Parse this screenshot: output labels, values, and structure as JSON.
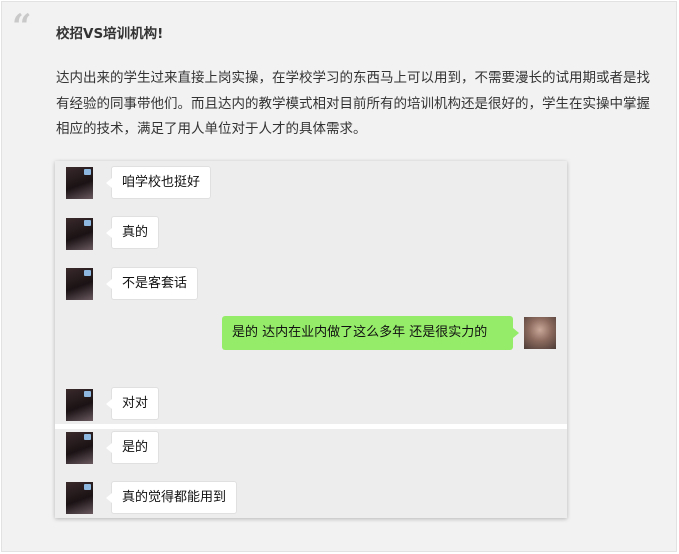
{
  "article": {
    "heading": "校招VS培训机构!",
    "paragraph": "达内出来的学生过来直接上岗实操，在学校学习的东西马上可以用到，不需要漫长的试用期或者是找有经验的同事带他们。而且达内的教学模式相对目前所有的培训机构还是很好的，学生在实操中掌握相应的技术，满足了用人单位对于人才的具体需求。"
  },
  "chat": {
    "messages": [
      {
        "side": "left",
        "text": "咱学校也挺好"
      },
      {
        "side": "left",
        "text": "真的"
      },
      {
        "side": "left",
        "text": "不是客套话"
      },
      {
        "side": "right",
        "text": "是的 达内在业内做了这么多年  还是很实力的"
      },
      {
        "side": "left",
        "text": "对对"
      },
      {
        "side": "left",
        "text": "是的"
      },
      {
        "side": "left",
        "text": "真的觉得都能用到"
      }
    ]
  },
  "colors": {
    "self_bubble": "#95ec69",
    "other_bubble": "#ffffff",
    "chat_background": "#ededed",
    "panel_background": "#f2f2f2"
  },
  "icons": {
    "quote": "quote-mark-icon"
  }
}
